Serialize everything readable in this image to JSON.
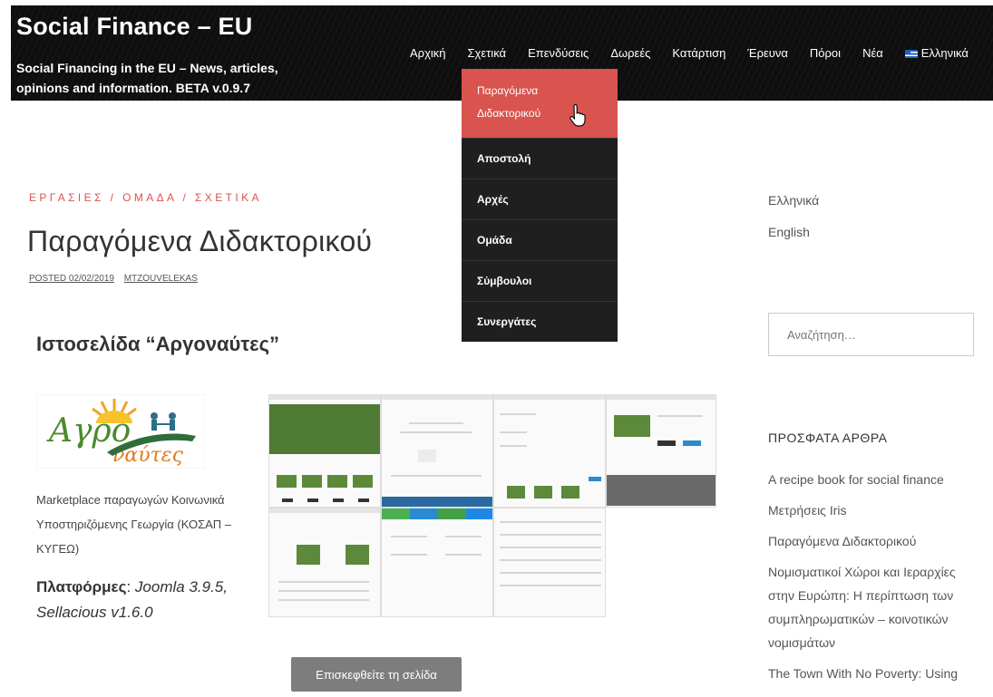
{
  "header": {
    "site_title": "Social Finance – EU",
    "site_description": "Social Financing in the EU – News, articles, opinions and information. BETA v.0.9.7",
    "nav": [
      "Αρχική",
      "Σχετικά",
      "Επενδύσεις",
      "Δωρεές",
      "Κατάρτιση",
      "Έρευνα",
      "Πόροι",
      "Νέα"
    ],
    "language": "Ελληνικά",
    "language_icon": "greek-flag-icon"
  },
  "dropdown": {
    "items": [
      "Παραγόμενα Διδακτορικού",
      "Αποστολή",
      "Αρχές",
      "Ομάδα",
      "Σύμβουλοι",
      "Συνεργάτες"
    ],
    "active_index": 0,
    "active_color": "#d9534f"
  },
  "article": {
    "breadcrumb": "ΕΡΓΑΣΙΕΣ / ΟΜΑΔΑ / ΣΧΕΤΙΚΑ",
    "title": "Παραγόμενα Διδακτορικού",
    "posted": "POSTED 02/02/2019",
    "author": "MTZOUVELEKAS",
    "section_title": "Ιστοσελίδα “Αργοναύτες”",
    "logo_text_1": "Αγρο",
    "logo_text_2": "ναύτες",
    "description": "Marketplace παραγωγών Κοινωνικά Υποστηριζόμενης Γεωργία (ΚΟΣΑΠ – ΚΥΓΕΩ)",
    "platforms_label": "Πλατφόρμες",
    "platforms_value": "Joomla 3.9.5, Sellacious v1.6.0",
    "visit_button": "Επισκεφθείτε τη σελίδα"
  },
  "sidebar": {
    "languages": [
      "Ελληνικά",
      "English"
    ],
    "search_placeholder": "Αναζήτηση…",
    "recent_heading": "ΠΡΟΣΦΑΤΑ ΑΡΘΡΑ",
    "recent_posts": [
      "A recipe book for social finance",
      "Μετρήσεις Iris",
      "Παραγόμενα Διδακτορικού",
      "Νομισματικοί Χώροι και Ιεραρχίες στην Ευρώπη: Η περίπτωση των συμπληρωματικών – κοινοτικών νομισμάτων",
      "The Town With No Poverty: Using"
    ]
  },
  "colors": {
    "accent": "#d9534f",
    "header_bg": "#0e0e0e",
    "button_bg": "#7d7d7d"
  }
}
